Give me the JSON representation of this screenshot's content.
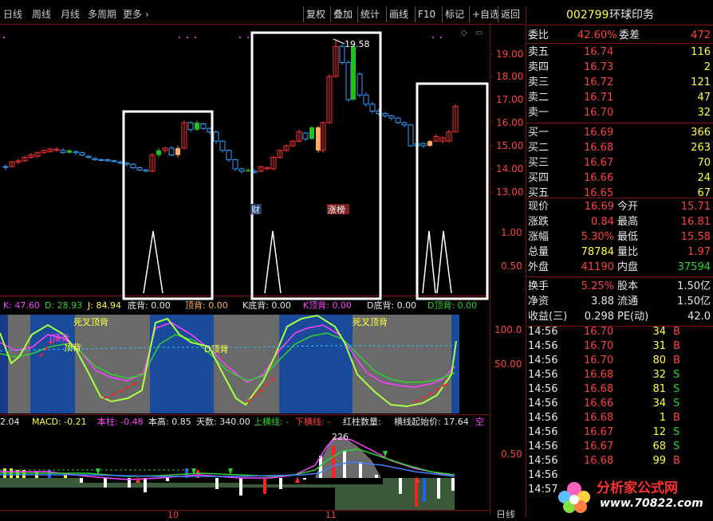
{
  "toolbar": {
    "left": [
      "日线",
      "周线",
      "月线",
      "多周期",
      "更多"
    ],
    "right": [
      "复权",
      "叠加",
      "统计",
      "画线",
      "F10",
      "标记",
      "+自选",
      "返回"
    ]
  },
  "stock": {
    "code": "002799",
    "name": "环球印务"
  },
  "quote": {
    "weibi_label": "委比",
    "weibi": "42.60%",
    "weicha_label": "委差",
    "weicha": "472",
    "sell": [
      {
        "label": "卖五",
        "price": "16.74",
        "vol": "116"
      },
      {
        "label": "卖四",
        "price": "16.73",
        "vol": "2"
      },
      {
        "label": "卖三",
        "price": "16.72",
        "vol": "121"
      },
      {
        "label": "卖二",
        "price": "16.71",
        "vol": "47"
      },
      {
        "label": "卖一",
        "price": "16.70",
        "vol": "32"
      }
    ],
    "buy": [
      {
        "label": "买一",
        "price": "16.69",
        "vol": "366"
      },
      {
        "label": "买二",
        "price": "16.68",
        "vol": "263"
      },
      {
        "label": "买三",
        "price": "16.67",
        "vol": "70"
      },
      {
        "label": "买四",
        "price": "16.66",
        "vol": "24"
      },
      {
        "label": "买五",
        "price": "16.65",
        "vol": "67"
      }
    ],
    "stats": [
      {
        "l1": "现价",
        "v1": "16.69",
        "l2": "今开",
        "v2": "15.71"
      },
      {
        "l1": "涨跌",
        "v1": "0.84",
        "l2": "最高",
        "v2": "16.81"
      },
      {
        "l1": "涨幅",
        "v1": "5.30%",
        "l2": "最低",
        "v2": "15.58"
      },
      {
        "l1": "总量",
        "v1": "78784",
        "l2": "量比",
        "v2": "1.97"
      },
      {
        "l1": "外盘",
        "v1": "41190",
        "l2": "内盘",
        "v2": "37594"
      }
    ],
    "stats2": [
      {
        "l1": "换手",
        "v1": "5.25%",
        "l2": "股本",
        "v2": "1.50亿"
      },
      {
        "l1": "净资",
        "v1": "3.88",
        "l2": "流通",
        "v2": "1.50亿"
      },
      {
        "l1": "收益(三)",
        "v1": "0.298",
        "l2": "PE(动)",
        "v2": "42.0"
      }
    ]
  },
  "ticks": [
    {
      "time": "14:56",
      "price": "16.70",
      "vol": "34",
      "bs": "B"
    },
    {
      "time": "14:56",
      "price": "16.70",
      "vol": "31",
      "bs": "B"
    },
    {
      "time": "14:56",
      "price": "16.70",
      "vol": "80",
      "bs": "B"
    },
    {
      "time": "14:56",
      "price": "16.68",
      "vol": "32",
      "bs": "S"
    },
    {
      "time": "14:56",
      "price": "16.68",
      "vol": "81",
      "bs": "S"
    },
    {
      "time": "14:56",
      "price": "16.66",
      "vol": "34",
      "bs": "S"
    },
    {
      "time": "14:56",
      "price": "16.68",
      "vol": "1",
      "bs": "B"
    },
    {
      "time": "14:56",
      "price": "16.67",
      "vol": "12",
      "bs": "S"
    },
    {
      "time": "14:56",
      "price": "16.67",
      "vol": "68",
      "bs": "S"
    },
    {
      "time": "14:56",
      "price": "16.68",
      "vol": "99",
      "bs": "B"
    },
    {
      "time": "14:56",
      "price": "",
      "vol": "",
      "bs": ""
    },
    {
      "time": "14:57",
      "price": "",
      "vol": "",
      "bs": ""
    }
  ],
  "chart": {
    "price_axis": [
      "19.00",
      "18.00",
      "17.00",
      "16.00",
      "15.00",
      "14.00",
      "13.00"
    ],
    "peak_label": "19.58",
    "tags": [
      "财",
      "涨榜"
    ],
    "sub_axis": [
      "1.00",
      "0.50"
    ],
    "kdj_legend": {
      "k": "K: 47.60",
      "d": "D: 28.93",
      "j": "J: 84.94"
    },
    "kdj_labels": [
      "底背: 0.00",
      "顶背: 0.00",
      "K底背: 0.00",
      "K顶背: 0.00",
      "D底背: 0.00",
      "D顶背: 0.00"
    ],
    "kdj_axis": [
      "100.0",
      "50.00"
    ],
    "kdj_notes": [
      "死叉顶背",
      "死叉顶背",
      "顶背",
      "顶背",
      "D顶背",
      "J顶背"
    ],
    "macd_legend": {
      "dif": "2.04",
      "macd": "MACD: -0.21",
      "bar": "本柱: -0.48",
      "high": "本高: 0.85",
      "days": "天数: 340.00",
      "up": "上横线: -",
      "down": "下横线: -",
      "red": "红柱数量:",
      "start": "横线起始价: 17.64",
      "kong": "空"
    },
    "macd_axis": [
      "0.50"
    ],
    "macd_peak": "226",
    "x_labels": [
      "10",
      "11"
    ],
    "period_tag": "日线"
  },
  "colors": {
    "up": "#ff3030",
    "down": "#30a0ff",
    "accent_green": "#20c020",
    "accent_orange": "#ffb060",
    "box": "#ffffff"
  },
  "watermark": {
    "title": "分析家公式网",
    "url": "www.70822.com"
  }
}
